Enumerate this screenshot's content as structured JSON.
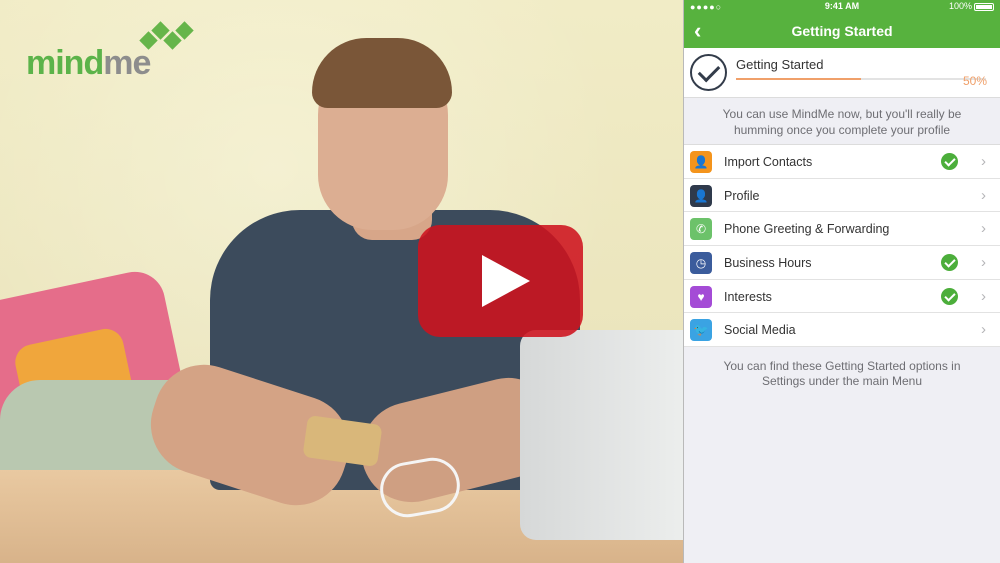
{
  "logo": {
    "part1": "mind",
    "part2": "me"
  },
  "video": {
    "play_icon": "play-icon"
  },
  "status_bar": {
    "signal": "●●●●○",
    "wifi_icon": "wifi-icon",
    "time": "9:41 AM",
    "battery_pct": "100%"
  },
  "nav": {
    "back_icon": "chevron-left-icon",
    "back_glyph": "‹",
    "title": "Getting Started"
  },
  "progress": {
    "label": "Getting Started",
    "percent_text": "50%",
    "fraction": 0.5,
    "accent": "#f0a06a"
  },
  "intro_text": "You can use MindMe now, but you'll really be humming once you complete your profile",
  "menu": [
    {
      "label": "Import Contacts",
      "icon": "import-contacts-icon",
      "glyph": "👤",
      "color": "#f4941c",
      "done": true
    },
    {
      "label": "Profile",
      "icon": "profile-icon",
      "glyph": "👤",
      "color": "#2f3a4c",
      "done": false
    },
    {
      "label": "Phone Greeting & Forwarding",
      "icon": "phone-icon",
      "glyph": "✆",
      "color": "#6cc26a",
      "done": false
    },
    {
      "label": "Business Hours",
      "icon": "clock-icon",
      "glyph": "◷",
      "color": "#3b5c9c",
      "done": true
    },
    {
      "label": "Interests",
      "icon": "heart-icon",
      "glyph": "♥",
      "color": "#a44bd6",
      "done": true
    },
    {
      "label": "Social Media",
      "icon": "twitter-icon",
      "glyph": "🐦",
      "color": "#3aa3e3",
      "done": false
    }
  ],
  "chevron_glyph": "›",
  "footer_text": "You can find these Getting Started options in Settings under the main Menu",
  "colors": {
    "brand_green": "#57b23e",
    "play_red": "#ce121e"
  }
}
